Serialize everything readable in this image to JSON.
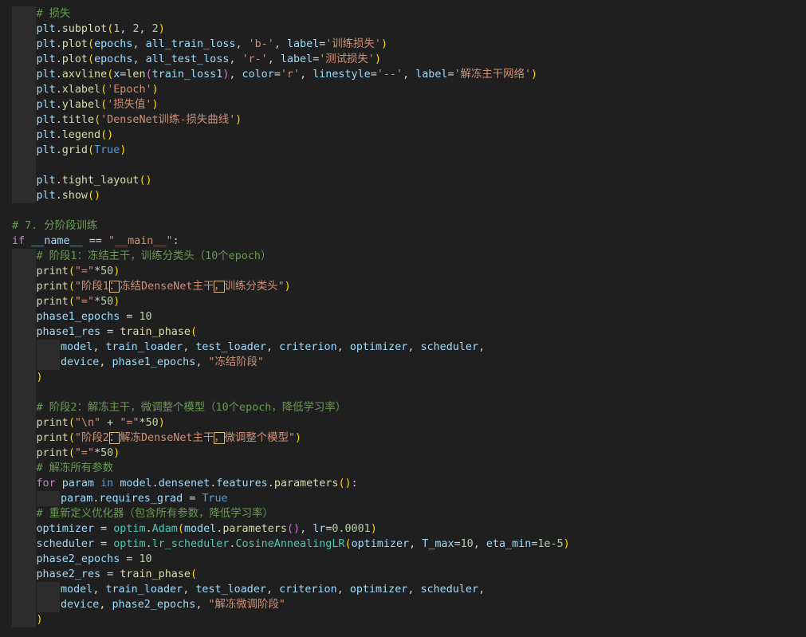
{
  "editor": {
    "language": "python",
    "lines": [
      {
        "indent": 1,
        "tokens": [
          [
            "cmt",
            "# 损失"
          ]
        ]
      },
      {
        "indent": 1,
        "tokens": [
          [
            "var",
            "plt"
          ],
          [
            "op",
            "."
          ],
          [
            "fn",
            "subplot"
          ],
          [
            "p1",
            "("
          ],
          [
            "num",
            "1"
          ],
          [
            "op",
            ", "
          ],
          [
            "num",
            "2"
          ],
          [
            "op",
            ", "
          ],
          [
            "num",
            "2"
          ],
          [
            "p1",
            ")"
          ]
        ]
      },
      {
        "indent": 1,
        "tokens": [
          [
            "var",
            "plt"
          ],
          [
            "op",
            "."
          ],
          [
            "fn",
            "plot"
          ],
          [
            "p1",
            "("
          ],
          [
            "var",
            "epochs"
          ],
          [
            "op",
            ", "
          ],
          [
            "var",
            "all_train_loss"
          ],
          [
            "op",
            ", "
          ],
          [
            "str",
            "'b-'"
          ],
          [
            "op",
            ", "
          ],
          [
            "var",
            "label"
          ],
          [
            "op",
            "="
          ],
          [
            "str",
            "'训练损失'"
          ],
          [
            "p1",
            ")"
          ]
        ]
      },
      {
        "indent": 1,
        "tokens": [
          [
            "var",
            "plt"
          ],
          [
            "op",
            "."
          ],
          [
            "fn",
            "plot"
          ],
          [
            "p1",
            "("
          ],
          [
            "var",
            "epochs"
          ],
          [
            "op",
            ", "
          ],
          [
            "var",
            "all_test_loss"
          ],
          [
            "op",
            ", "
          ],
          [
            "str",
            "'r-'"
          ],
          [
            "op",
            ", "
          ],
          [
            "var",
            "label"
          ],
          [
            "op",
            "="
          ],
          [
            "str",
            "'测试损失'"
          ],
          [
            "p1",
            ")"
          ]
        ]
      },
      {
        "indent": 1,
        "tokens": [
          [
            "var",
            "plt"
          ],
          [
            "op",
            "."
          ],
          [
            "fn",
            "axvline"
          ],
          [
            "p1",
            "("
          ],
          [
            "var",
            "x"
          ],
          [
            "op",
            "="
          ],
          [
            "fn",
            "len"
          ],
          [
            "p2",
            "("
          ],
          [
            "var",
            "train_loss1"
          ],
          [
            "p2",
            ")"
          ],
          [
            "op",
            ", "
          ],
          [
            "var",
            "color"
          ],
          [
            "op",
            "="
          ],
          [
            "str",
            "'r'"
          ],
          [
            "op",
            ", "
          ],
          [
            "var",
            "linestyle"
          ],
          [
            "op",
            "="
          ],
          [
            "str",
            "'--'"
          ],
          [
            "op",
            ", "
          ],
          [
            "var",
            "label"
          ],
          [
            "op",
            "="
          ],
          [
            "str",
            "'解冻主干网络'"
          ],
          [
            "p1",
            ")"
          ]
        ]
      },
      {
        "indent": 1,
        "tokens": [
          [
            "var",
            "plt"
          ],
          [
            "op",
            "."
          ],
          [
            "fn",
            "xlabel"
          ],
          [
            "p1",
            "("
          ],
          [
            "str",
            "'Epoch'"
          ],
          [
            "p1",
            ")"
          ]
        ]
      },
      {
        "indent": 1,
        "tokens": [
          [
            "var",
            "plt"
          ],
          [
            "op",
            "."
          ],
          [
            "fn",
            "ylabel"
          ],
          [
            "p1",
            "("
          ],
          [
            "str",
            "'损失值'"
          ],
          [
            "p1",
            ")"
          ]
        ]
      },
      {
        "indent": 1,
        "tokens": [
          [
            "var",
            "plt"
          ],
          [
            "op",
            "."
          ],
          [
            "fn",
            "title"
          ],
          [
            "p1",
            "("
          ],
          [
            "str",
            "'DenseNet训练-损失曲线'"
          ],
          [
            "p1",
            ")"
          ]
        ]
      },
      {
        "indent": 1,
        "tokens": [
          [
            "var",
            "plt"
          ],
          [
            "op",
            "."
          ],
          [
            "fn",
            "legend"
          ],
          [
            "p1",
            "()"
          ]
        ]
      },
      {
        "indent": 1,
        "tokens": [
          [
            "var",
            "plt"
          ],
          [
            "op",
            "."
          ],
          [
            "fn",
            "grid"
          ],
          [
            "p1",
            "("
          ],
          [
            "kw2",
            "True"
          ],
          [
            "p1",
            ")"
          ]
        ]
      },
      {
        "indent": 1,
        "tokens": []
      },
      {
        "indent": 1,
        "tokens": [
          [
            "var",
            "plt"
          ],
          [
            "op",
            "."
          ],
          [
            "fn",
            "tight_layout"
          ],
          [
            "p1",
            "()"
          ]
        ]
      },
      {
        "indent": 1,
        "tokens": [
          [
            "var",
            "plt"
          ],
          [
            "op",
            "."
          ],
          [
            "fn",
            "show"
          ],
          [
            "p1",
            "()"
          ]
        ]
      },
      {
        "indent": 0,
        "tokens": []
      },
      {
        "indent": 0,
        "tokens": [
          [
            "cmt",
            "# 7. 分阶段训练"
          ]
        ]
      },
      {
        "indent": 0,
        "tokens": [
          [
            "kw",
            "if"
          ],
          [
            "op",
            " "
          ],
          [
            "var",
            "__name__"
          ],
          [
            "op",
            " == "
          ],
          [
            "str",
            "\"__main__\""
          ],
          [
            "op",
            ":"
          ]
        ]
      },
      {
        "indent": 1,
        "tokens": [
          [
            "cmt",
            "# 阶段1：冻结主干，训练分类头（10个epoch）"
          ]
        ]
      },
      {
        "indent": 1,
        "tokens": [
          [
            "fn",
            "print"
          ],
          [
            "p1",
            "("
          ],
          [
            "str",
            "\"=\""
          ],
          [
            "op",
            "*"
          ],
          [
            "num",
            "50"
          ],
          [
            "p1",
            ")"
          ]
        ]
      },
      {
        "indent": 1,
        "tokens": [
          [
            "fn",
            "print"
          ],
          [
            "p1",
            "("
          ],
          [
            "str",
            "\"阶段1"
          ],
          [
            "strhl",
            "："
          ],
          [
            "str",
            "冻结DenseNet主干"
          ],
          [
            "strhl",
            "，"
          ],
          [
            "str",
            "训练分类头\""
          ],
          [
            "p1",
            ")"
          ]
        ]
      },
      {
        "indent": 1,
        "tokens": [
          [
            "fn",
            "print"
          ],
          [
            "p1",
            "("
          ],
          [
            "str",
            "\"=\""
          ],
          [
            "op",
            "*"
          ],
          [
            "num",
            "50"
          ],
          [
            "p1",
            ")"
          ]
        ]
      },
      {
        "indent": 1,
        "tokens": [
          [
            "var",
            "phase1_epochs"
          ],
          [
            "op",
            " = "
          ],
          [
            "num",
            "10"
          ]
        ]
      },
      {
        "indent": 1,
        "tokens": [
          [
            "var",
            "phase1_res"
          ],
          [
            "op",
            " = "
          ],
          [
            "fn",
            "train_phase"
          ],
          [
            "p1",
            "("
          ]
        ]
      },
      {
        "indent": 2,
        "tokens": [
          [
            "var",
            "model"
          ],
          [
            "op",
            ", "
          ],
          [
            "var",
            "train_loader"
          ],
          [
            "op",
            ", "
          ],
          [
            "var",
            "test_loader"
          ],
          [
            "op",
            ", "
          ],
          [
            "var",
            "criterion"
          ],
          [
            "op",
            ", "
          ],
          [
            "var",
            "optimizer"
          ],
          [
            "op",
            ", "
          ],
          [
            "var",
            "scheduler"
          ],
          [
            "op",
            ","
          ]
        ]
      },
      {
        "indent": 2,
        "tokens": [
          [
            "var",
            "device"
          ],
          [
            "op",
            ", "
          ],
          [
            "var",
            "phase1_epochs"
          ],
          [
            "op",
            ", "
          ],
          [
            "str",
            "\"冻结阶段\""
          ]
        ]
      },
      {
        "indent": 1,
        "tokens": [
          [
            "p1",
            ")"
          ]
        ]
      },
      {
        "indent": 1,
        "tokens": []
      },
      {
        "indent": 1,
        "tokens": [
          [
            "cmt",
            "# 阶段2：解冻主干，微调整个模型（10个epoch，降低学习率）"
          ]
        ]
      },
      {
        "indent": 1,
        "tokens": [
          [
            "fn",
            "print"
          ],
          [
            "p1",
            "("
          ],
          [
            "str",
            "\"\\n\""
          ],
          [
            "op",
            " + "
          ],
          [
            "str",
            "\"=\""
          ],
          [
            "op",
            "*"
          ],
          [
            "num",
            "50"
          ],
          [
            "p1",
            ")"
          ]
        ]
      },
      {
        "indent": 1,
        "tokens": [
          [
            "fn",
            "print"
          ],
          [
            "p1",
            "("
          ],
          [
            "str",
            "\"阶段2"
          ],
          [
            "strhl",
            "："
          ],
          [
            "str",
            "解冻DenseNet主干"
          ],
          [
            "strhl",
            "，"
          ],
          [
            "str",
            "微调整个模型\""
          ],
          [
            "p1",
            ")"
          ]
        ]
      },
      {
        "indent": 1,
        "tokens": [
          [
            "fn",
            "print"
          ],
          [
            "p1",
            "("
          ],
          [
            "str",
            "\"=\""
          ],
          [
            "op",
            "*"
          ],
          [
            "num",
            "50"
          ],
          [
            "p1",
            ")"
          ]
        ]
      },
      {
        "indent": 1,
        "tokens": [
          [
            "cmt",
            "# 解冻所有参数"
          ]
        ]
      },
      {
        "indent": 1,
        "tokens": [
          [
            "kw",
            "for"
          ],
          [
            "op",
            " "
          ],
          [
            "var",
            "param"
          ],
          [
            "op",
            " "
          ],
          [
            "kw2",
            "in"
          ],
          [
            "op",
            " "
          ],
          [
            "var",
            "model"
          ],
          [
            "op",
            "."
          ],
          [
            "var",
            "densenet"
          ],
          [
            "op",
            "."
          ],
          [
            "var",
            "features"
          ],
          [
            "op",
            "."
          ],
          [
            "fn",
            "parameters"
          ],
          [
            "p1",
            "()"
          ],
          [
            "op",
            ":"
          ]
        ]
      },
      {
        "indent": 2,
        "tokens": [
          [
            "var",
            "param"
          ],
          [
            "op",
            "."
          ],
          [
            "var",
            "requires_grad"
          ],
          [
            "op",
            " = "
          ],
          [
            "kw2",
            "True"
          ]
        ]
      },
      {
        "indent": 1,
        "tokens": [
          [
            "cmt",
            "# 重新定义优化器（包含所有参数，降低学习率）"
          ]
        ]
      },
      {
        "indent": 1,
        "tokens": [
          [
            "var",
            "optimizer"
          ],
          [
            "op",
            " = "
          ],
          [
            "cls",
            "optim"
          ],
          [
            "op",
            "."
          ],
          [
            "cls",
            "Adam"
          ],
          [
            "p1",
            "("
          ],
          [
            "var",
            "model"
          ],
          [
            "op",
            "."
          ],
          [
            "fn",
            "parameters"
          ],
          [
            "p2",
            "()"
          ],
          [
            "op",
            ", "
          ],
          [
            "var",
            "lr"
          ],
          [
            "op",
            "="
          ],
          [
            "num",
            "0.0001"
          ],
          [
            "p1",
            ")"
          ]
        ]
      },
      {
        "indent": 1,
        "tokens": [
          [
            "var",
            "scheduler"
          ],
          [
            "op",
            " = "
          ],
          [
            "cls",
            "optim"
          ],
          [
            "op",
            "."
          ],
          [
            "cls",
            "lr_scheduler"
          ],
          [
            "op",
            "."
          ],
          [
            "cls",
            "CosineAnnealingLR"
          ],
          [
            "p1",
            "("
          ],
          [
            "var",
            "optimizer"
          ],
          [
            "op",
            ", "
          ],
          [
            "var",
            "T_max"
          ],
          [
            "op",
            "="
          ],
          [
            "num",
            "10"
          ],
          [
            "op",
            ", "
          ],
          [
            "var",
            "eta_min"
          ],
          [
            "op",
            "="
          ],
          [
            "num",
            "1e-5"
          ],
          [
            "p1",
            ")"
          ]
        ]
      },
      {
        "indent": 1,
        "tokens": [
          [
            "var",
            "phase2_epochs"
          ],
          [
            "op",
            " = "
          ],
          [
            "num",
            "10"
          ]
        ]
      },
      {
        "indent": 1,
        "tokens": [
          [
            "var",
            "phase2_res"
          ],
          [
            "op",
            " = "
          ],
          [
            "fn",
            "train_phase"
          ],
          [
            "p1",
            "("
          ]
        ]
      },
      {
        "indent": 2,
        "tokens": [
          [
            "var",
            "model"
          ],
          [
            "op",
            ", "
          ],
          [
            "var",
            "train_loader"
          ],
          [
            "op",
            ", "
          ],
          [
            "var",
            "test_loader"
          ],
          [
            "op",
            ", "
          ],
          [
            "var",
            "criterion"
          ],
          [
            "op",
            ", "
          ],
          [
            "var",
            "optimizer"
          ],
          [
            "op",
            ", "
          ],
          [
            "var",
            "scheduler"
          ],
          [
            "op",
            ","
          ]
        ]
      },
      {
        "indent": 2,
        "tokens": [
          [
            "var",
            "device"
          ],
          [
            "op",
            ", "
          ],
          [
            "var",
            "phase2_epochs"
          ],
          [
            "op",
            ", "
          ],
          [
            "str",
            "\"解冻微调阶段\""
          ]
        ]
      },
      {
        "indent": 1,
        "tokens": [
          [
            "p1",
            ")"
          ]
        ]
      }
    ]
  }
}
